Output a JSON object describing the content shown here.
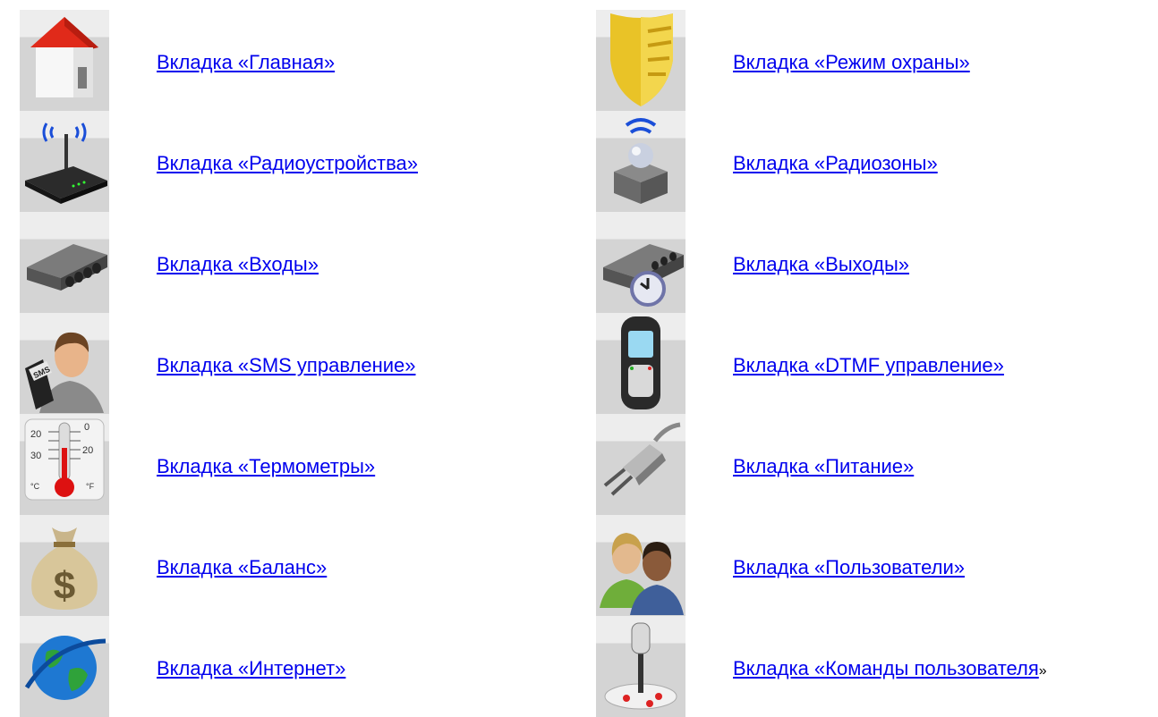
{
  "left_column": [
    {
      "icon": "house-icon",
      "label": "Вкладка «Главная»"
    },
    {
      "icon": "router-antenna-icon",
      "label": "Вкладка «Радиоустройства»"
    },
    {
      "icon": "input-block-icon",
      "label": "Вкладка «Входы»"
    },
    {
      "icon": "sms-user-icon",
      "label": "Вкладка «SMS управление»"
    },
    {
      "icon": "thermometer-icon",
      "label": "Вкладка «Термометры»"
    },
    {
      "icon": "money-bag-icon",
      "label": "Вкладка «Баланс»"
    },
    {
      "icon": "globe-icon",
      "label": "Вкладка «Интернет»"
    }
  ],
  "right_column": [
    {
      "icon": "shield-icon",
      "label": "Вкладка «Режим охраны»"
    },
    {
      "icon": "radio-sensor-icon",
      "label": "Вкладка «Радиозоны»"
    },
    {
      "icon": "output-clock-icon",
      "label": "Вкладка «Выходы»"
    },
    {
      "icon": "mobile-phone-icon",
      "label": "Вкладка «DTMF управление»"
    },
    {
      "icon": "power-plug-icon",
      "label": "Вкладка «Питание»"
    },
    {
      "icon": "users-icon",
      "label": "Вкладка «Пользователи»"
    },
    {
      "icon": "joystick-icon",
      "label": "Вкладка «Команды пользователя",
      "suffix": "»"
    }
  ],
  "thermometer": {
    "scale_c_top": "20",
    "scale_c_bottom": "30",
    "scale_f_top": "0",
    "scale_f_bottom": "20",
    "unit_c": "°C",
    "unit_f": "°F"
  },
  "sms_badge": "SMS",
  "colors": {
    "link": "#0000ee",
    "tile_top": "#ededed",
    "tile_bottom": "#d4d4d4"
  }
}
